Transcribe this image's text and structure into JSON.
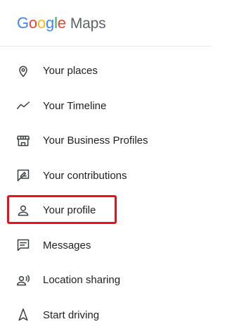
{
  "header": {
    "logo": {
      "letters": [
        {
          "char": "G",
          "color": "#4285F4"
        },
        {
          "char": "o",
          "color": "#EA4335"
        },
        {
          "char": "o",
          "color": "#FBBC05"
        },
        {
          "char": "g",
          "color": "#4285F4"
        },
        {
          "char": "l",
          "color": "#34A853"
        },
        {
          "char": "e",
          "color": "#EA4335"
        }
      ],
      "product": "Maps"
    }
  },
  "menu": {
    "items": [
      {
        "label": "Your places",
        "icon": "location-pin-icon"
      },
      {
        "label": "Your Timeline",
        "icon": "timeline-icon"
      },
      {
        "label": "Your Business Profiles",
        "icon": "storefront-icon"
      },
      {
        "label": "Your contributions",
        "icon": "rate-review-icon"
      },
      {
        "label": "Your profile",
        "icon": "person-icon",
        "highlighted": true
      },
      {
        "label": "Messages",
        "icon": "message-icon"
      },
      {
        "label": "Location sharing",
        "icon": "location-sharing-icon"
      },
      {
        "label": "Start driving",
        "icon": "navigation-icon"
      }
    ]
  },
  "colors": {
    "highlight": "#e3131b",
    "text": "#202124",
    "icon": "#3c4043"
  }
}
